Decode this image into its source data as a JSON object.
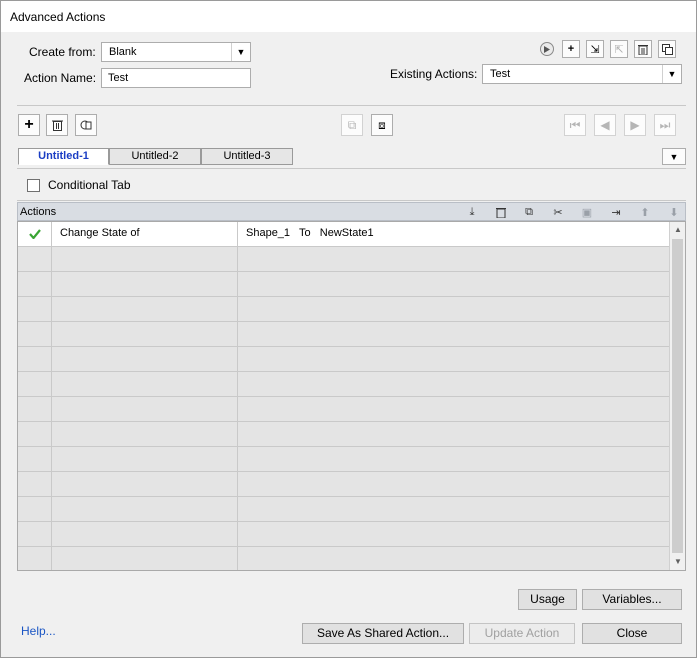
{
  "window": {
    "title": "Advanced Actions"
  },
  "form": {
    "create_from_label": "Create from:",
    "create_from_value": "Blank",
    "action_name_label": "Action Name:",
    "action_name_value": "Test",
    "existing_actions_label": "Existing Actions:",
    "existing_actions_value": "Test"
  },
  "tabs": [
    {
      "label": "Untitled-1",
      "active": true
    },
    {
      "label": "Untitled-2",
      "active": false
    },
    {
      "label": "Untitled-3",
      "active": false
    }
  ],
  "conditional_tab_label": "Conditional Tab",
  "actions_header": "Actions",
  "actions": [
    {
      "checked": true,
      "action": "Change State of",
      "target": "Shape_1   To   NewState1"
    }
  ],
  "buttons": {
    "usage": "Usage",
    "variables": "Variables...",
    "save_shared": "Save As Shared Action...",
    "update_action": "Update Action",
    "close": "Close"
  },
  "help_link": "Help...",
  "colors": {
    "accent": "#1a3dc4",
    "check": "#3aa534",
    "link": "#1a55c4"
  }
}
